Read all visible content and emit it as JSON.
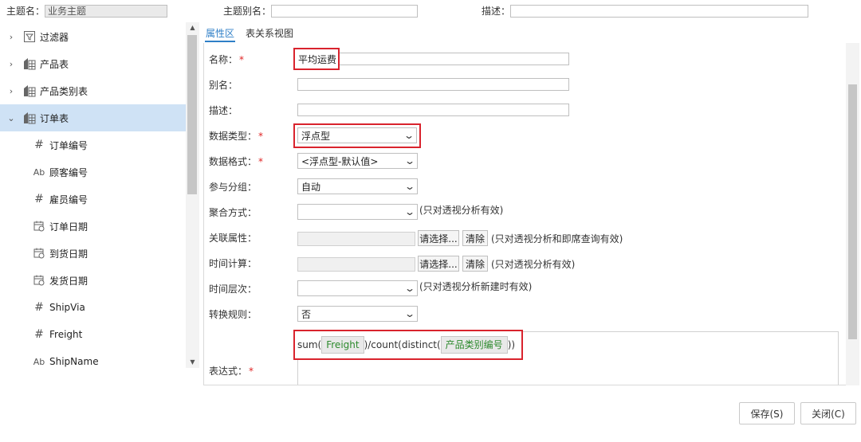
{
  "header": {
    "topic_name_label": "主题名：",
    "topic_name_value": "业务主题",
    "alias_label": "主题别名：",
    "alias_value": "",
    "desc_label": "描述：",
    "desc_value": ""
  },
  "tree": {
    "items": [
      {
        "label": "过滤器",
        "icon": "filter-icon",
        "expand": "›",
        "level": 0
      },
      {
        "label": "产品表",
        "icon": "table-icon",
        "expand": "›",
        "level": 0
      },
      {
        "label": "产品类别表",
        "icon": "table-icon",
        "expand": "›",
        "level": 0
      },
      {
        "label": "订单表",
        "icon": "table-icon",
        "expand": "⌄",
        "level": 0,
        "selected": true
      },
      {
        "label": "订单编号",
        "icon": "hash-icon",
        "glyph": "#",
        "level": 1
      },
      {
        "label": "顾客编号",
        "icon": "text-field-icon",
        "glyph": "Ab",
        "level": 1
      },
      {
        "label": "雇员编号",
        "icon": "hash-icon",
        "glyph": "#",
        "level": 1
      },
      {
        "label": "订单日期",
        "icon": "calendar-icon",
        "level": 1
      },
      {
        "label": "到货日期",
        "icon": "calendar-icon",
        "level": 1
      },
      {
        "label": "发货日期",
        "icon": "calendar-icon",
        "level": 1
      },
      {
        "label": "ShipVia",
        "icon": "hash-icon",
        "glyph": "#",
        "level": 1
      },
      {
        "label": "Freight",
        "icon": "hash-icon",
        "glyph": "#",
        "level": 1
      },
      {
        "label": "ShipName",
        "icon": "text-field-icon",
        "glyph": "Ab",
        "level": 1
      }
    ]
  },
  "tabs": [
    {
      "label": "属性区",
      "active": true
    },
    {
      "label": "表关系视图",
      "active": false
    }
  ],
  "form": {
    "name_label": "名称：",
    "name_value": "平均运费",
    "alias_label": "别名：",
    "alias_value": "",
    "desc_label": "描述：",
    "desc_value": "",
    "data_type_label": "数据类型：",
    "data_type_value": "浮点型",
    "data_format_label": "数据格式：",
    "data_format_value": "<浮点型-默认值>",
    "grouping_label": "参与分组：",
    "grouping_value": "自动",
    "aggregate_label": "聚合方式：",
    "aggregate_value": "",
    "aggregate_note": "(只对透视分析有效)",
    "related_label": "关联属性：",
    "related_note": "(只对透视分析和即席查询有效)",
    "timecalc_label": "时间计算：",
    "timecalc_note": "(只对透视分析有效)",
    "timelevel_label": "时间层次：",
    "timelevel_value": "",
    "timelevel_note": "(只对透视分析新建时有效)",
    "convert_label": "转换规则：",
    "convert_value": "否",
    "expr_label": "表达式：",
    "select_btn": "请选择...",
    "clear_btn": "清除",
    "required_mark": "*",
    "expression": {
      "prefix": "sum(",
      "field1": "Freight",
      "middle": ")/count(distinct(",
      "field2": "产品类别编号",
      "suffix": "))"
    }
  },
  "footer": {
    "save_label": "保存(S)",
    "close_label": "关闭(C)"
  },
  "colors": {
    "highlight_red": "#d9232d",
    "tab_active": "#2f7fc7",
    "tree_selected": "#cfe2f5",
    "chip_text": "#2d8a2d"
  }
}
